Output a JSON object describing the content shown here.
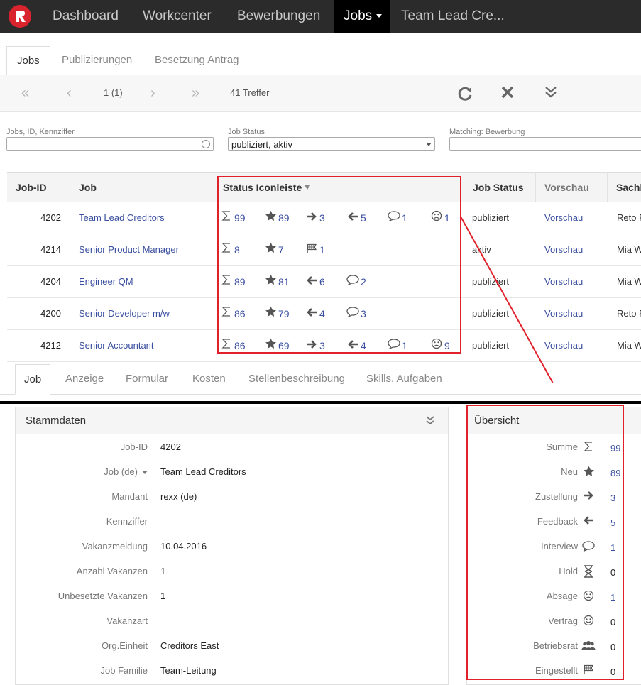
{
  "nav": {
    "items": [
      "Dashboard",
      "Workcenter",
      "Bewerbungen",
      "Jobs",
      "Team Lead Cre..."
    ],
    "active": "Jobs"
  },
  "subtabs": [
    "Jobs",
    "Publizierungen",
    "Besetzung Antrag"
  ],
  "pager": {
    "page": "1 (1)",
    "hits": "41 Treffer"
  },
  "filters": {
    "search_label": "Jobs, ID, Kennziffer",
    "search_value": "",
    "status_label": "Job Status",
    "status_value": "publiziert, aktiv",
    "matching_label": "Matching: Bewerbung",
    "matching_value": ""
  },
  "table": {
    "headers": [
      "Job-ID",
      "Job",
      "Status Iconleiste",
      "Job Status",
      "Vorschau",
      "Sachb"
    ],
    "rows": [
      {
        "id": "4202",
        "job": "Team Lead Creditors",
        "status": "publiziert",
        "vorschau": "Vorschau",
        "sach": "Reto F",
        "icons": [
          [
            "sigma",
            "99"
          ],
          [
            "star",
            "89"
          ],
          [
            "arrow-right",
            "3"
          ],
          [
            "arrow-left",
            "5"
          ],
          [
            "bubble",
            "1"
          ],
          [
            "sad",
            "1"
          ]
        ]
      },
      {
        "id": "4214",
        "job": "Senior Product Manager",
        "status": "aktiv",
        "vorschau": "Vorschau",
        "sach": "Mia W",
        "icons": [
          [
            "sigma",
            "8"
          ],
          [
            "star",
            "7"
          ],
          [
            "flag",
            "1"
          ]
        ]
      },
      {
        "id": "4204",
        "job": "Engineer QM",
        "status": "publiziert",
        "vorschau": "Vorschau",
        "sach": "Mia W",
        "icons": [
          [
            "sigma",
            "89"
          ],
          [
            "star",
            "81"
          ],
          [
            "arrow-left",
            "6"
          ],
          [
            "bubble",
            "2"
          ]
        ]
      },
      {
        "id": "4200",
        "job": "Senior Developer m/w",
        "status": "publiziert",
        "vorschau": "Vorschau",
        "sach": "Reto F",
        "icons": [
          [
            "sigma",
            "86"
          ],
          [
            "star",
            "79"
          ],
          [
            "arrow-left",
            "4"
          ],
          [
            "bubble",
            "3"
          ]
        ]
      },
      {
        "id": "4212",
        "job": "Senior Accountant",
        "status": "publiziert",
        "vorschau": "Vorschau",
        "sach": "Mia W",
        "icons": [
          [
            "sigma",
            "86"
          ],
          [
            "star",
            "69"
          ],
          [
            "arrow-right",
            "3"
          ],
          [
            "arrow-left",
            "4"
          ],
          [
            "bubble",
            "1"
          ],
          [
            "sad",
            "9"
          ]
        ]
      }
    ]
  },
  "detail_tabs": [
    "Job",
    "Anzeige",
    "Formular",
    "Kosten",
    "Stellenbeschreibung",
    "Skills, Aufgaben"
  ],
  "stammdaten": {
    "title": "Stammdaten",
    "fields": [
      {
        "label": "Job-ID",
        "value": "4202"
      },
      {
        "label": "Job (de)",
        "value": "Team Lead Creditors"
      },
      {
        "label": "Mandant",
        "value": "rexx (de)"
      },
      {
        "label": "Kennziffer",
        "value": ""
      },
      {
        "label": "Vakanzmeldung",
        "value": "10.04.2016"
      },
      {
        "label": "Anzahl Vakanzen",
        "value": "1"
      },
      {
        "label": "Unbesetzte Vakanzen",
        "value": "1"
      },
      {
        "label": "Vakanzart",
        "value": ""
      },
      {
        "label": "Org.Einheit",
        "value": "Creditors East"
      },
      {
        "label": "Job Familie",
        "value": "Team-Leitung"
      }
    ]
  },
  "uebersicht": {
    "title": "Übersicht",
    "items": [
      {
        "label": "Summe",
        "icon": "sigma",
        "value": "99",
        "link": true
      },
      {
        "label": "Neu",
        "icon": "star",
        "value": "89",
        "link": true
      },
      {
        "label": "Zustellung",
        "icon": "arrow-right",
        "value": "3",
        "link": true
      },
      {
        "label": "Feedback",
        "icon": "arrow-left",
        "value": "5",
        "link": true
      },
      {
        "label": "Interview",
        "icon": "bubble",
        "value": "1",
        "link": true
      },
      {
        "label": "Hold",
        "icon": "hourglass",
        "value": "0",
        "link": false
      },
      {
        "label": "Absage",
        "icon": "sad",
        "value": "1",
        "link": true
      },
      {
        "label": "Vertrag",
        "icon": "smile",
        "value": "0",
        "link": false
      },
      {
        "label": "Betriebsrat",
        "icon": "group",
        "value": "0",
        "link": false
      },
      {
        "label": "Eingestellt",
        "icon": "flag",
        "value": "0",
        "link": false
      }
    ]
  },
  "colors": {
    "accent_red": "#e0202a",
    "link": "#3a4fa0",
    "nav_bg": "#2b2b2b"
  }
}
